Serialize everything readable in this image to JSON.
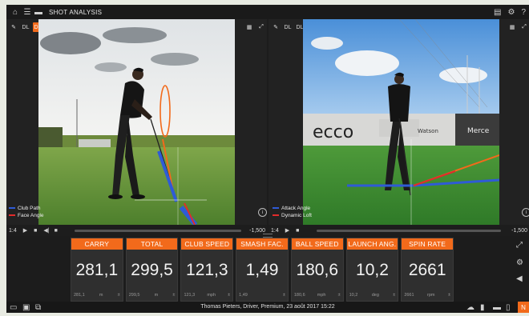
{
  "app": {
    "title": "SHOT ANALYSIS"
  },
  "left_panel": {
    "tools": [
      "DL",
      "DL",
      "FO"
    ],
    "legend": [
      "Club Path",
      "Face Angle"
    ],
    "speed": "1:4",
    "time": "-1,500"
  },
  "right_panel": {
    "tools": [
      "DL",
      "DL",
      "FO"
    ],
    "legend": [
      "Attack Angle",
      "Dynamic Loft"
    ],
    "speed": "1:4",
    "time": "-1,500",
    "banner": {
      "logo": "ecco",
      "small": "Watson",
      "right": "Merce"
    }
  },
  "metrics": [
    {
      "label": "CARRY",
      "value": "281,1",
      "sub": "281,1",
      "unit": "m"
    },
    {
      "label": "TOTAL",
      "value": "299,5",
      "sub": "299,5",
      "unit": "m"
    },
    {
      "label": "CLUB SPEED",
      "value": "121,3",
      "sub": "121,3",
      "unit": "mph"
    },
    {
      "label": "SMASH FAC.",
      "value": "1,49",
      "sub": "1,49",
      "unit": ""
    },
    {
      "label": "BALL SPEED",
      "value": "180,6",
      "sub": "180,6",
      "unit": "mph"
    },
    {
      "label": "LAUNCH ANG.",
      "value": "10,2",
      "sub": "10,2",
      "unit": "deg"
    },
    {
      "label": "SPIN RATE",
      "value": "2661",
      "sub": "2661",
      "unit": "rpm"
    }
  ],
  "status": {
    "text": "Thomas Pieters, Driver, Premium, 23 août 2017 15:22",
    "badge": "N"
  },
  "colors": {
    "accent": "#f26a1b",
    "club_path": "#2f5bd6",
    "face_angle": "#e22b2b"
  }
}
